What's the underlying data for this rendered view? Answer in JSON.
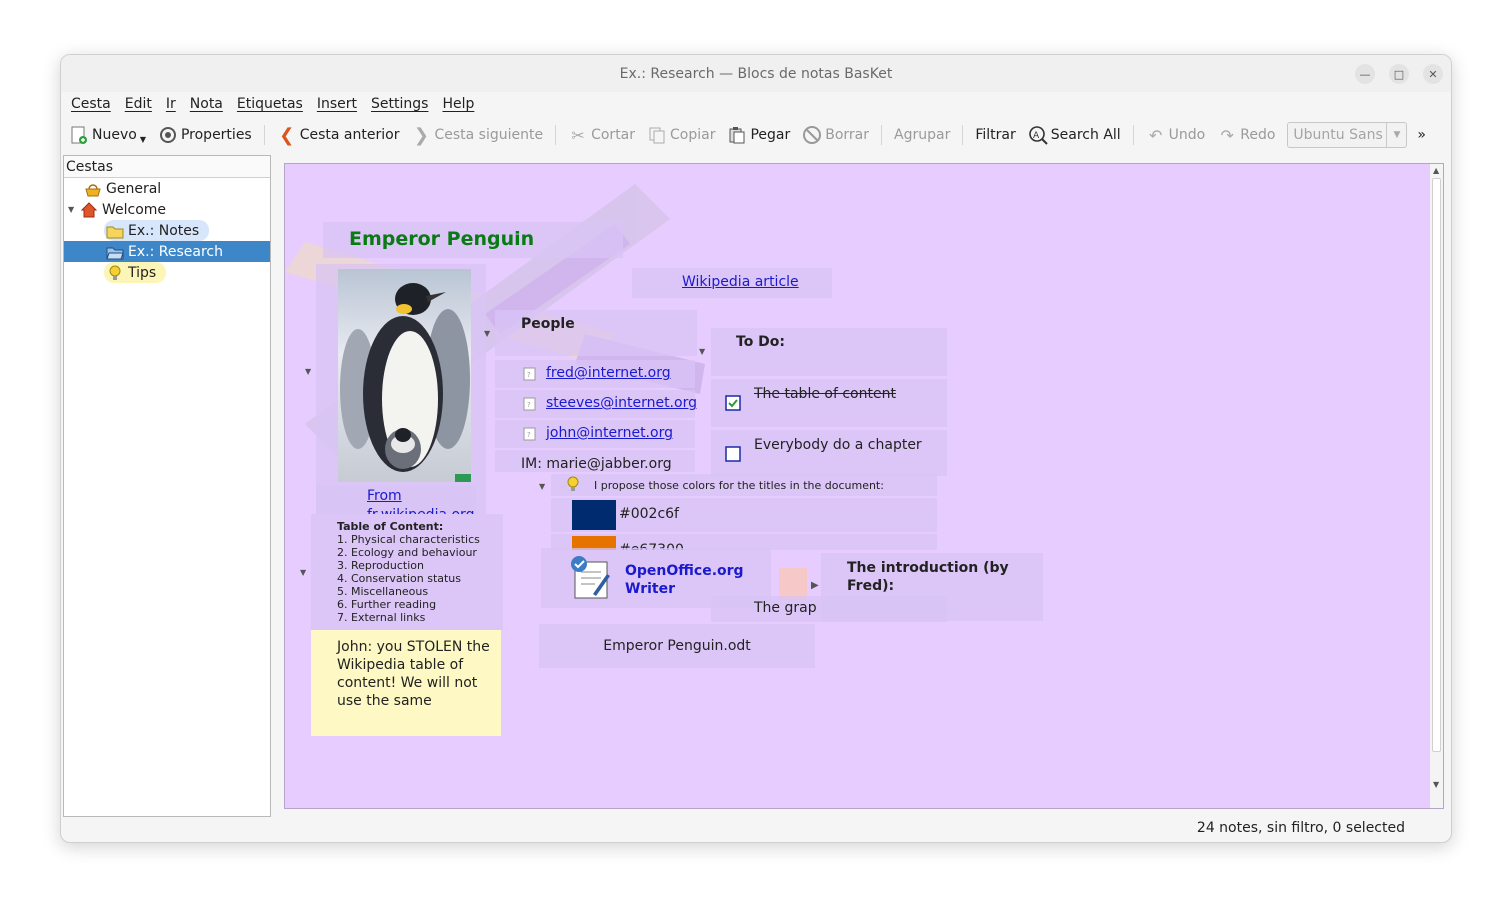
{
  "window": {
    "title": "Ex.: Research — Blocs de notas BasKet"
  },
  "menu": [
    "Cesta",
    "Edit",
    "Ir",
    "Nota",
    "Etiquetas",
    "Insert",
    "Settings",
    "Help"
  ],
  "toolbar": {
    "nuevo": "Nuevo",
    "properties": "Properties",
    "cesta_anterior": "Cesta anterior",
    "cesta_siguiente": "Cesta siguiente",
    "cortar": "Cortar",
    "copiar": "Copiar",
    "pegar": "Pegar",
    "borrar": "Borrar",
    "agrupar": "Agrupar",
    "filtrar": "Filtrar",
    "search_all": "Search All",
    "undo": "Undo",
    "redo": "Redo",
    "font": "Ubuntu Sans",
    "more": "»"
  },
  "sidebar": {
    "header": "Cestas",
    "items": [
      {
        "label": "General"
      },
      {
        "label": "Welcome"
      },
      {
        "label": "Ex.: Notes"
      },
      {
        "label": "Ex.: Research"
      },
      {
        "label": "Tips"
      }
    ]
  },
  "notes": {
    "title": "Emperor Penguin",
    "wiki_link": "Wikipedia article",
    "image_caption_1": "From",
    "image_caption_2": "fr.wikipedia.org",
    "people": {
      "title": "People",
      "emails": [
        "fred@internet.org",
        "steeves@internet.org",
        "john@internet.org"
      ],
      "im": "IM: marie@jabber.org"
    },
    "todo": {
      "title": "To Do:",
      "items": [
        {
          "label": "The table of content",
          "done": true
        },
        {
          "label": "Everybody do a chapter",
          "done": false
        },
        {
          "label": "The grap",
          "done": false
        }
      ]
    },
    "colors": {
      "intro": "I propose those colors for the titles in the document:",
      "swatches": [
        {
          "hex": "#002c6f",
          "label": "#002c6f"
        },
        {
          "hex": "#e67300",
          "label": "#e67300"
        }
      ]
    },
    "toc": {
      "title": "Table of Content:",
      "items": [
        "1. Physical characteristics",
        "2. Ecology and behaviour",
        "3. Reproduction",
        "4. Conservation status",
        "5. Miscellaneous",
        "6. Further reading",
        "7. External links"
      ]
    },
    "sticky": "John: you STOLEN the Wikipedia table of content! We will not use the same",
    "oo_writer": "OpenOffice.org Writer",
    "odt_file": "Emperor Penguin.odt",
    "intro_fred": "The introduction (by Fred):",
    "colors_accent": {
      "title_green": "#0a7a14",
      "link_blue": "#1a1acc"
    }
  },
  "status": "24 notes, sin filtro, 0 selected"
}
